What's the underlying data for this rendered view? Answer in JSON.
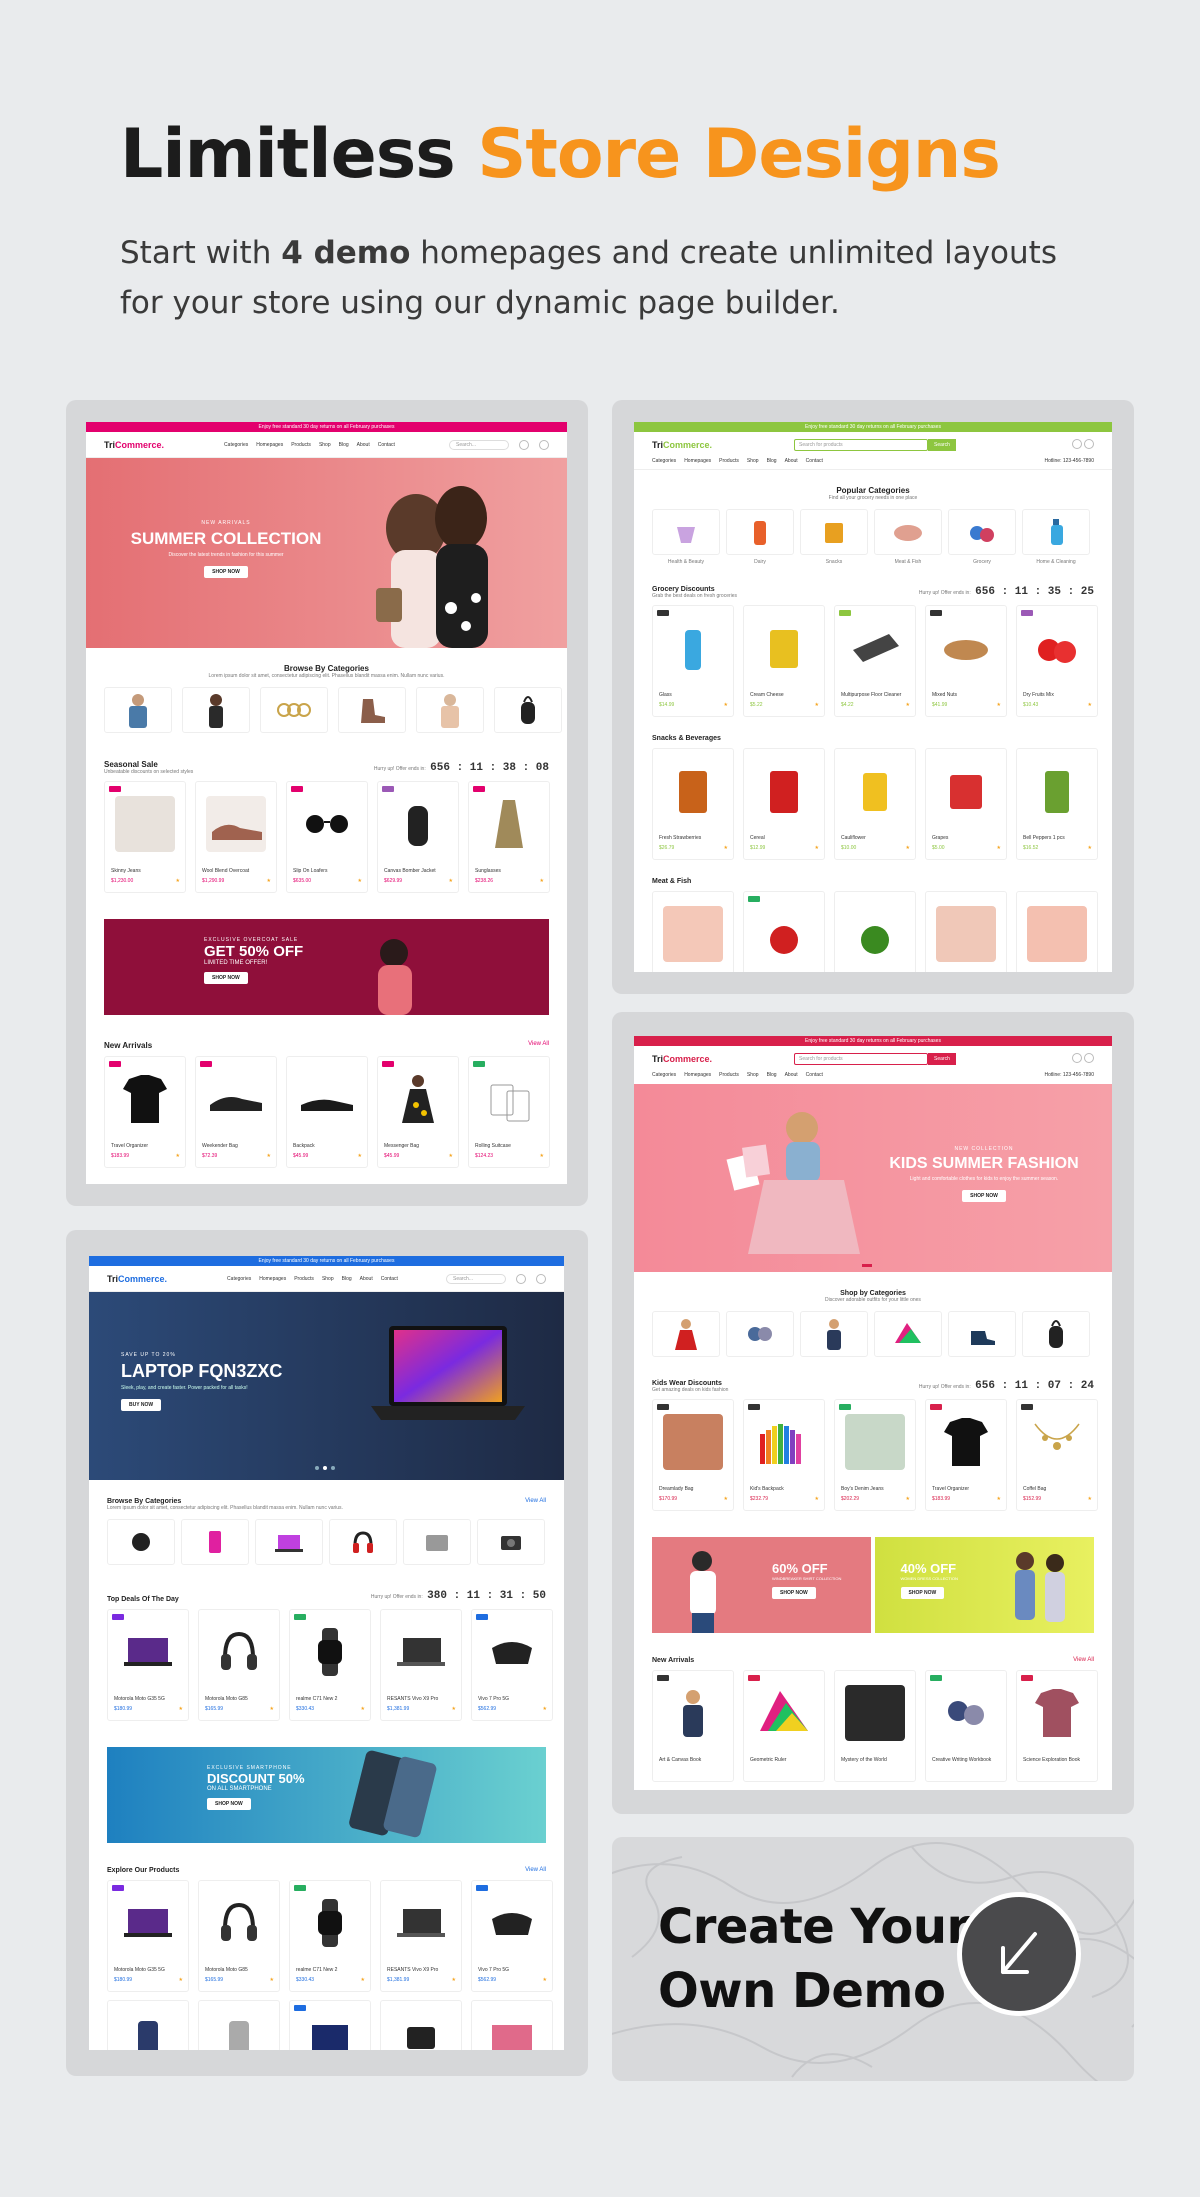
{
  "hero": {
    "title_main": "Limitless ",
    "title_accent": "Store Designs",
    "sub_pre": "Start with ",
    "sub_bold": "4 demo",
    "sub_post": " homepages and create unlimited layouts for your store using our dynamic page builder."
  },
  "demo1": {
    "accent": "#e3006d",
    "topbar": "Enjoy free standard 30 day returns on all February purchases",
    "logo_a": "Tri",
    "logo_b": "Commerce.",
    "nav": [
      "Categories",
      "Homepages",
      "Products",
      "Shop",
      "Blog",
      "About",
      "Contact"
    ],
    "search": "Search...",
    "banner_small": "NEW ARRIVALS",
    "banner_title": "SUMMER COLLECTION",
    "banner_sub": "Discover the latest trends in fashion for this summer",
    "banner_btn": "SHOP NOW",
    "cats_title": "Browse By Categories",
    "cats_sub": "Lorem ipsum dolor sit amet, consectetur adipiscing elit. Phasellus blandit massa enim. Nullam nunc varius.",
    "seasonal_title": "Seasonal Sale",
    "seasonal_sub": "Unbeatable discounts on selected styles",
    "hurry": "Hurry up! Offer ends in:",
    "timer": "656 : 11 : 38 : 08",
    "products": [
      {
        "name": "Skinny Jeans",
        "price": "$1,230.00"
      },
      {
        "name": "Wool Blend Overcoat",
        "price": "$1,290.99"
      },
      {
        "name": "Slip On Loafers",
        "price": "$635.00"
      },
      {
        "name": "Canvas Bomber Jacket",
        "price": "$629.99"
      },
      {
        "name": "Sunglasses",
        "price": "$238.26"
      }
    ],
    "promo_small": "EXCLUSIVE OVERCOAT SALE",
    "promo_title": "GET 50% OFF",
    "promo_sub": "LIMITED TIME OFFER!",
    "promo_btn": "SHOP NOW",
    "arrivals_title": "New Arrivals",
    "view_all": "View All",
    "arrivals": [
      {
        "name": "Travel Organizer",
        "price": "$183.99"
      },
      {
        "name": "Weekender Bag",
        "price": "$72.39"
      },
      {
        "name": "Backpack",
        "price": "$45.99"
      },
      {
        "name": "Messenger Bag",
        "price": "$45.99"
      },
      {
        "name": "Rolling Suitcase",
        "price": "$124.23"
      }
    ]
  },
  "demo2": {
    "accent": "#8dc63f",
    "topbar": "Enjoy free standard 30 day returns on all February purchases",
    "logo_a": "Tri",
    "logo_b": "Commerce.",
    "search": "Search for products",
    "search_btn": "Search",
    "nav": [
      "Categories",
      "Homepages",
      "Products",
      "Shop",
      "Blog",
      "About",
      "Contact"
    ],
    "hotline": "Hotline: 123-456-7890",
    "cats_title": "Popular Categories",
    "cats_sub": "Find all your grocery needs in one place",
    "cats": [
      "Health & Beauty",
      "Dairy",
      "Snacks",
      "Meat & Fish",
      "Grocery",
      "Home & Cleaning"
    ],
    "grocery_title": "Grocery Discounts",
    "grocery_sub": "Grab the best deals on fresh groceries",
    "hurry": "Hurry up! Offer ends in:",
    "timer": "656 : 11 : 35 : 25",
    "grocery": [
      {
        "name": "Glass",
        "price": "$14.99"
      },
      {
        "name": "Cream Cheese",
        "price": "$5.22"
      },
      {
        "name": "Multipurpose Floor Cleaner",
        "price": "$4.22"
      },
      {
        "name": "Mixed Nuts",
        "price": "$41.99"
      },
      {
        "name": "Dry Fruits Mix",
        "price": "$10.43"
      }
    ],
    "snacks_title": "Snacks & Beverages",
    "snacks": [
      {
        "name": "Fresh Strawberries",
        "price": "$26.79"
      },
      {
        "name": "Cereal",
        "price": "$12.99"
      },
      {
        "name": "Cauliflower",
        "price": "$10.00"
      },
      {
        "name": "Grapes",
        "price": "$5.00"
      },
      {
        "name": "Bell Peppers 1 pcs",
        "price": "$16.52"
      }
    ],
    "meat_title": "Meat & Fish"
  },
  "demo3": {
    "accent": "#1e6de0",
    "topbar": "Enjoy free standard 30 day returns on all February purchases",
    "logo_a": "Tri",
    "logo_b": "Commerce.",
    "nav": [
      "Categories",
      "Homepages",
      "Products",
      "Shop",
      "Blog",
      "About",
      "Contact"
    ],
    "search": "Search...",
    "banner_small": "SAVE UP TO 20%",
    "banner_title": "LAPTOP FQN3ZXC",
    "banner_sub": "Sleek, play, and create faster. Power packed for all tasks!",
    "banner_btn": "BUY NOW",
    "cats_title": "Browse By Categories",
    "cats_sub": "Lorem ipsum dolor sit amet, consectetur adipiscing elit. Phasellus blandit massa enim. Nullam nunc varius.",
    "view_all": "View All",
    "deals_title": "Top Deals Of The Day",
    "hurry": "Hurry up! Offer ends in:",
    "timer": "380 : 11 : 31 : 50",
    "deals": [
      {
        "name": "Motorola Moto G35 5G",
        "price": "$180.99"
      },
      {
        "name": "Motorola Moto G85",
        "price": "$165.99"
      },
      {
        "name": "realme C71 New 2",
        "price": "$330.43"
      },
      {
        "name": "RESANTS Vivo X9 Pro",
        "price": "$1,381.99"
      },
      {
        "name": "Vivo 7 Pro 5G",
        "price": "$562.99"
      }
    ],
    "promo_small": "EXCLUSIVE SMARTPHONE",
    "promo_title": "DISCOUNT 50%",
    "promo_sub": "ON ALL SMARTPHONE",
    "promo_btn": "SHOP NOW",
    "explore_title": "Explore Our Products",
    "explore": [
      {
        "name": "Motorola Moto G35 5G",
        "price": "$180.99"
      },
      {
        "name": "Motorola Moto G85",
        "price": "$165.99"
      },
      {
        "name": "realme C71 New 2",
        "price": "$330.43"
      },
      {
        "name": "RESANTS Vivo X9 Pro",
        "price": "$1,381.99"
      },
      {
        "name": "Vivo 7 Pro 5G",
        "price": "$562.99"
      }
    ]
  },
  "demo4": {
    "accent": "#d8204b",
    "topbar": "Enjoy free standard 30 day returns on all February purchases",
    "logo_a": "Tri",
    "logo_b": "Commerce.",
    "search": "Search for products",
    "search_btn": "Search",
    "nav": [
      "Categories",
      "Homepages",
      "Products",
      "Shop",
      "Blog",
      "About",
      "Contact"
    ],
    "hotline": "Hotline: 123-456-7890",
    "banner_small": "NEW COLLECTION",
    "banner_title": "KIDS SUMMER FASHION",
    "banner_sub": "Light and comfortable clothes for kids to enjoy the summer season.",
    "banner_btn": "SHOP NOW",
    "cats_title": "Shop by Categories",
    "cats_sub": "Discover adorable outfits for your little ones",
    "kids_title": "Kids Wear Discounts",
    "kids_sub": "Get amazing deals on kids fashion",
    "hurry": "Hurry up! Offer ends in:",
    "timer": "656 : 11 : 07 : 24",
    "kids": [
      {
        "name": "Dreamlady Bag",
        "price": "$170.99"
      },
      {
        "name": "Kid's Backpack",
        "price": "$232.79"
      },
      {
        "name": "Boy's Denim Jeans",
        "price": "$202.29"
      },
      {
        "name": "Travel Organizer",
        "price": "$183.99"
      },
      {
        "name": "Coffel Bag",
        "price": "$152.99"
      }
    ],
    "promo1_title": "60% OFF",
    "promo1_sub": "WINDBREAKER SHIRT COLLECTION",
    "promo1_btn": "SHOP NOW",
    "promo2_title": "40% OFF",
    "promo2_sub": "WOMEN DRESS COLLECTION",
    "promo2_btn": "SHOP NOW",
    "arrivals_title": "New Arrivals",
    "view_all": "View All",
    "arrivals": [
      {
        "name": "Art & Canvas Book",
        "price": ""
      },
      {
        "name": "Geometric Ruler",
        "price": ""
      },
      {
        "name": "Mystery of the World",
        "price": ""
      },
      {
        "name": "Creative Writing Workbook",
        "price": ""
      },
      {
        "name": "Science Exploration Book",
        "price": ""
      }
    ]
  },
  "cta": {
    "text_line1": "Create Your",
    "text_line2": "Own Demo",
    "icon": "arrow-down-left-icon"
  }
}
